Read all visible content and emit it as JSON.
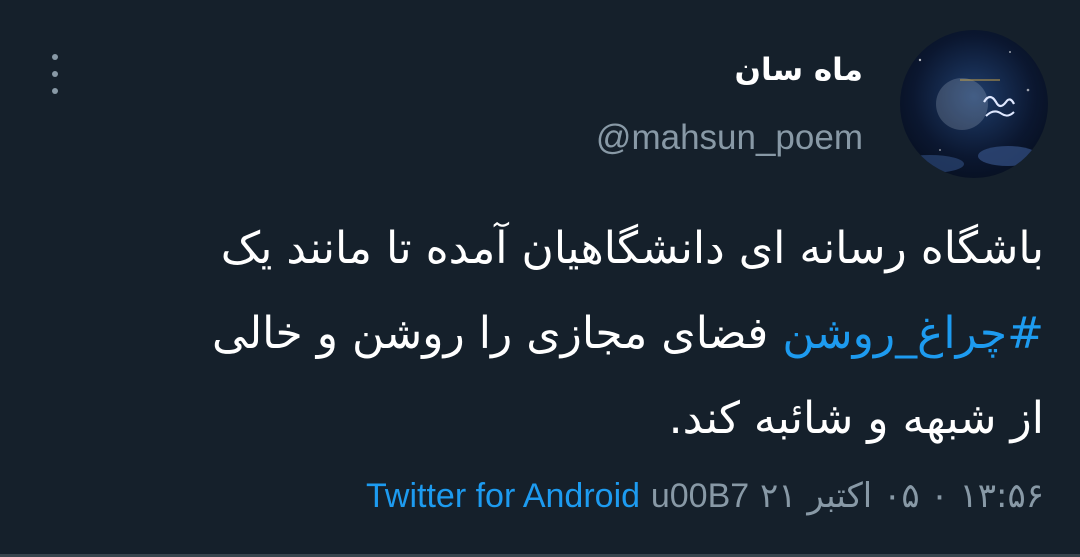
{
  "tweet": {
    "display_name": "ماه سان",
    "handle": "@mahsun_poem",
    "text_line1": "باشگاه رسانه ای دانشگاهیان آمده تا مانند یک",
    "hashtag": "#چراغ_روشن",
    "text_line2_rest": " فضای مجازی را روشن و خالی",
    "text_line3": "از شبهه و شائبه کند.",
    "timestamp": "۱۳:۵۶ ۰ ۰۵ اکتبر ۲۱",
    "separator": "u00B7",
    "source": "Twitter for Android",
    "more_icon": "more-vertical-icon",
    "colors": {
      "background": "#15202b",
      "text": "#ffffff",
      "muted": "#8899a6",
      "link": "#1d9bf0"
    }
  }
}
